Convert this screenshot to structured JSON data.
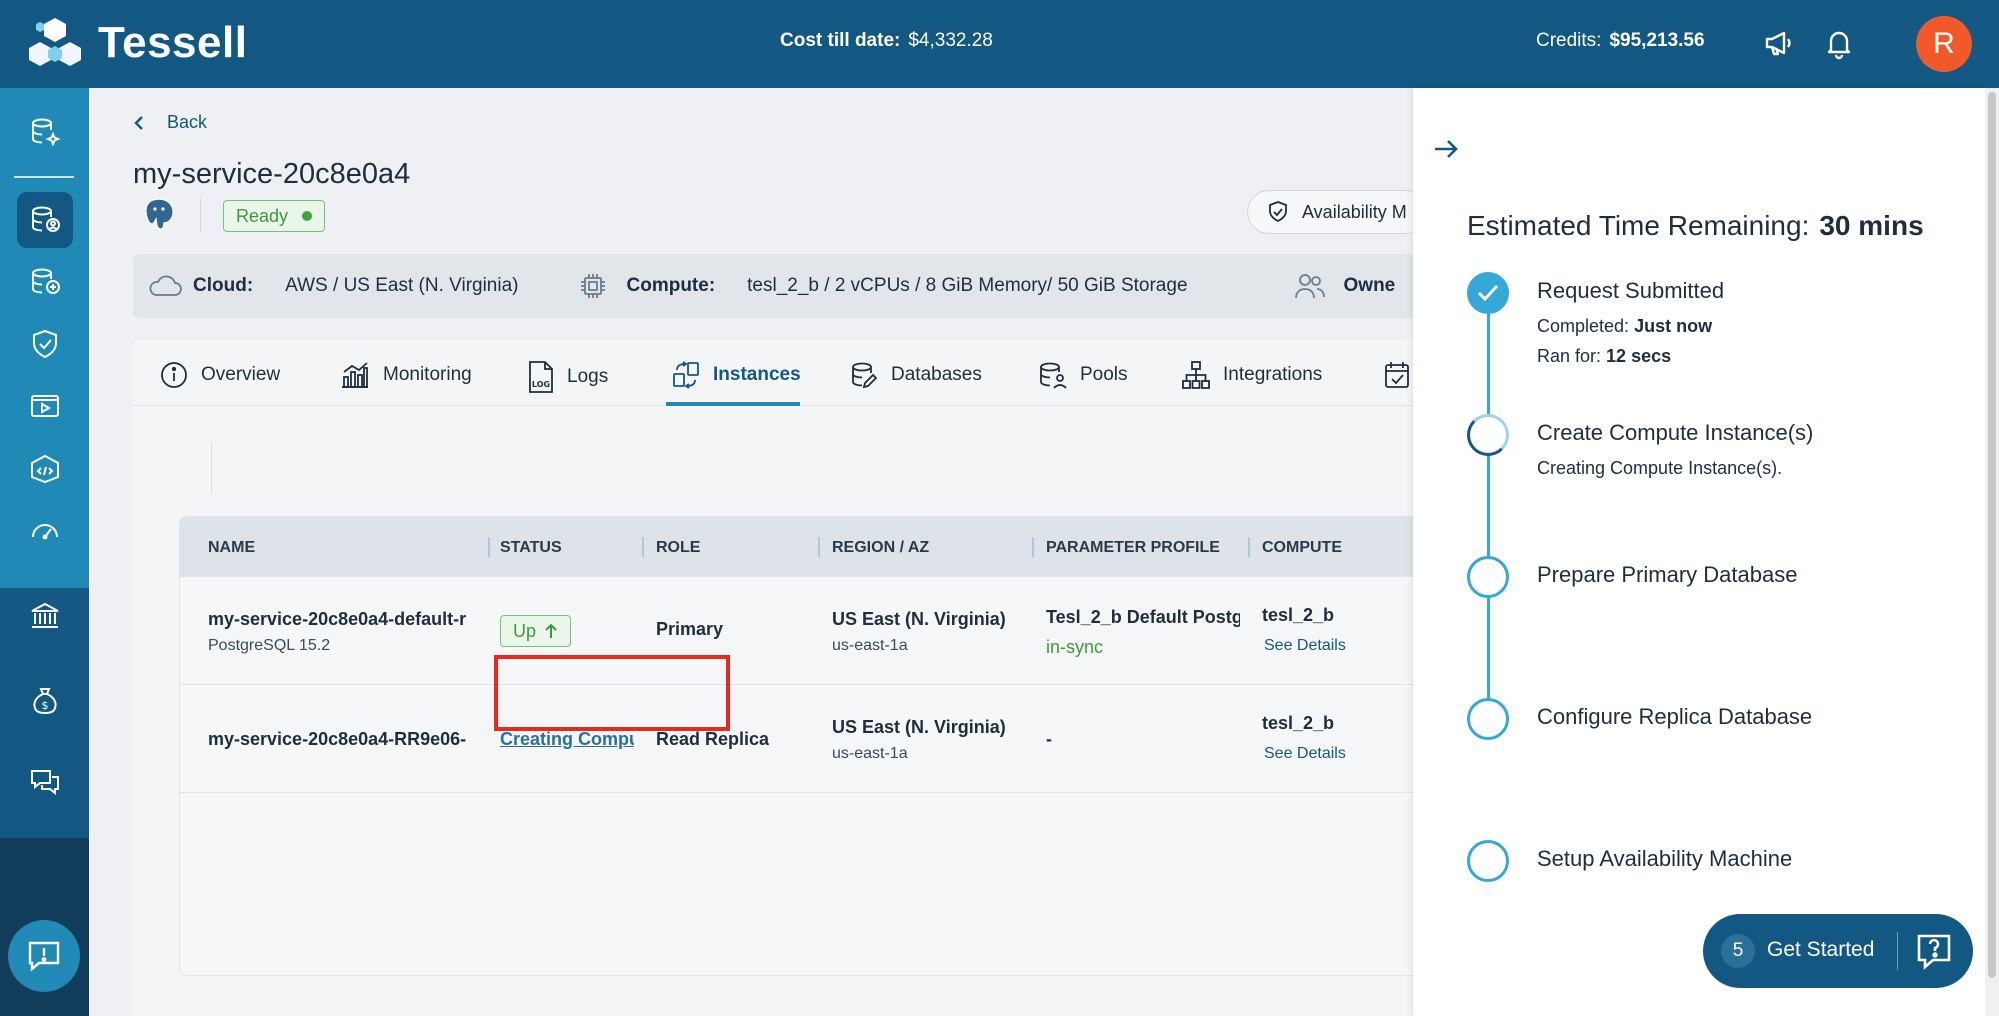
{
  "app": {
    "brand": "Tessell"
  },
  "header": {
    "cost_label": "Cost till date:",
    "cost_value": "$4,332.28",
    "credits_label": "Credits:",
    "credits_value": "$95,213.56",
    "avatar_initial": "R"
  },
  "page": {
    "back_label": "Back",
    "service_name": "my-service-20c8e0a4",
    "status": "Ready",
    "availability_label": "Availability M"
  },
  "info": {
    "cloud_label": "Cloud:",
    "cloud_value": "AWS / US East (N. Virginia)",
    "compute_label": "Compute:",
    "compute_value": "tesl_2_b / 2 vCPUs / 8 GiB Memory/ 50 GiB Storage",
    "owner_label": "Owne"
  },
  "tabs": [
    {
      "label": "Overview"
    },
    {
      "label": "Monitoring"
    },
    {
      "label": "Logs"
    },
    {
      "label": "Instances"
    },
    {
      "label": "Databases"
    },
    {
      "label": "Pools"
    },
    {
      "label": "Integrations"
    }
  ],
  "table": {
    "headers": [
      "NAME",
      "STATUS",
      "ROLE",
      "REGION / AZ",
      "PARAMETER PROFILE",
      "COMPUTE"
    ],
    "rows": [
      {
        "name": "my-service-20c8e0a4-default-r",
        "version": "PostgreSQL 15.2",
        "status": "Up",
        "role": "Primary",
        "region": "US East (N. Virginia)",
        "az": "us-east-1a",
        "profile": "Tesl_2_b Default Postg",
        "profile_state": "in-sync",
        "compute": "tesl_2_b",
        "details_link": "See Details"
      },
      {
        "name": "my-service-20c8e0a4-RR9e06-",
        "status": "Creating Compu",
        "role": "Read Replica",
        "region": "US East (N. Virginia)",
        "az": "us-east-1a",
        "profile": "-",
        "compute": "tesl_2_b",
        "details_link": "See Details"
      }
    ]
  },
  "drawer": {
    "etr_label": "Estimated Time Remaining:",
    "etr_value": "30 mins",
    "steps": [
      {
        "title": "Request Submitted",
        "completed_label": "Completed:",
        "completed_value": "Just now",
        "ran_label": "Ran for:",
        "ran_value": "12 secs",
        "state": "done"
      },
      {
        "title": "Create Compute Instance(s)",
        "subtitle": "Creating Compute Instance(s).",
        "state": "in-progress"
      },
      {
        "title": "Prepare Primary Database",
        "state": "pending"
      },
      {
        "title": "Configure Replica Database",
        "state": "pending"
      },
      {
        "title": "Setup Availability Machine",
        "state": "pending"
      }
    ]
  },
  "get_started": {
    "count": "5",
    "label": "Get Started"
  },
  "colors": {
    "header_bg": "#135783",
    "nav_bg": "#2089b5",
    "accent": "#35a8d8",
    "success": "#3a9a3a",
    "highlight": "#e8291d",
    "avatar": "#f05a2a"
  }
}
